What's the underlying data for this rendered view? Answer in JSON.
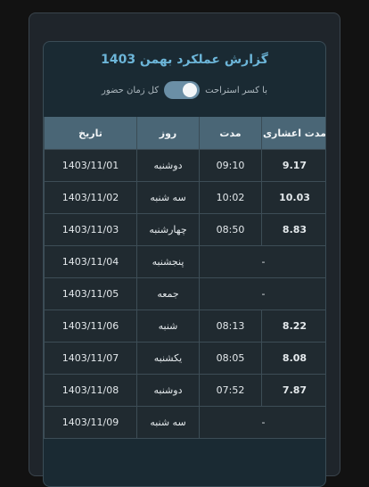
{
  "report": {
    "title": "گزارش عملکرد بهمن 1403",
    "toggle_label_break": "با کسر استراحت",
    "toggle_label_total": "کل زمان حضور",
    "toggle_on": true
  },
  "table": {
    "headers": {
      "decimal": "مدت اعشاری",
      "duration": "مدت",
      "day": "روز",
      "date": "تاریخ"
    },
    "rows": [
      {
        "decimal": "9.17",
        "duration": "09:10",
        "day": "دوشنبه",
        "date": "1403/11/01"
      },
      {
        "decimal": "10.03",
        "duration": "10:02",
        "day": "سه شنبه",
        "date": "1403/11/02"
      },
      {
        "decimal": "8.83",
        "duration": "08:50",
        "day": "چهارشنبه",
        "date": "1403/11/03"
      },
      {
        "empty": "-",
        "day": "پنجشنبه",
        "date": "1403/11/04"
      },
      {
        "empty": "-",
        "day": "جمعه",
        "date": "1403/11/05"
      },
      {
        "decimal": "8.22",
        "duration": "08:13",
        "day": "شنبه",
        "date": "1403/11/06"
      },
      {
        "decimal": "8.08",
        "duration": "08:05",
        "day": "یکشنبه",
        "date": "1403/11/07"
      },
      {
        "decimal": "7.87",
        "duration": "07:52",
        "day": "دوشنبه",
        "date": "1403/11/08"
      },
      {
        "empty": "-",
        "day": "سه شنبه",
        "date": "1403/11/09"
      }
    ]
  }
}
